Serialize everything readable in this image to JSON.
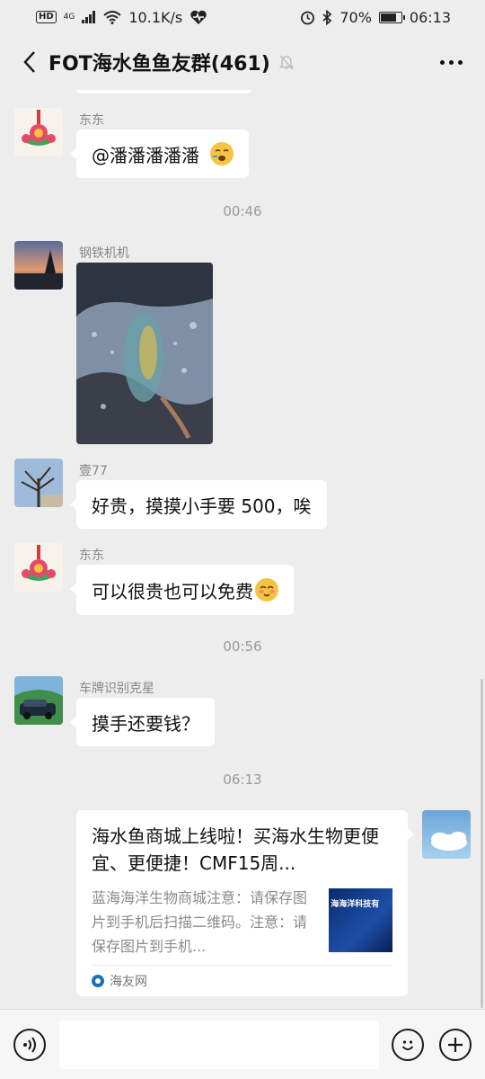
{
  "status_bar": {
    "hd": "HD",
    "network": "4G",
    "speed": "10.1K/s",
    "battery": "70%",
    "battery_level": 0.7,
    "time": "06:13"
  },
  "header": {
    "title": "FOT海水鱼鱼友群(461)"
  },
  "messages": [
    {
      "type": "text",
      "sender": "东东",
      "text": "@潘潘潘潘潘"
    },
    {
      "type": "time",
      "text": "00:46"
    },
    {
      "type": "image",
      "sender": "钢铁机机"
    },
    {
      "type": "text",
      "sender": "壹77",
      "text": "好贵，摸摸小手要 500，唉"
    },
    {
      "type": "text",
      "sender": "东东",
      "text": "可以很贵也可以免费"
    },
    {
      "type": "time",
      "text": "00:56"
    },
    {
      "type": "text",
      "sender": "车牌识别克星",
      "text": "摸手还要钱？"
    },
    {
      "type": "time",
      "text": "06:13"
    }
  ],
  "link_card": {
    "title": "海水鱼商城上线啦！买海水生物更便宜、更便捷！CMF15周...",
    "description": "蓝海海洋生物商城注意：请保存图片到手机后扫描二维码。注意：请保存图片到手机...",
    "thumb_text": "海海洋科技有",
    "source": "海友网"
  },
  "input_bar": {
    "value": ""
  }
}
